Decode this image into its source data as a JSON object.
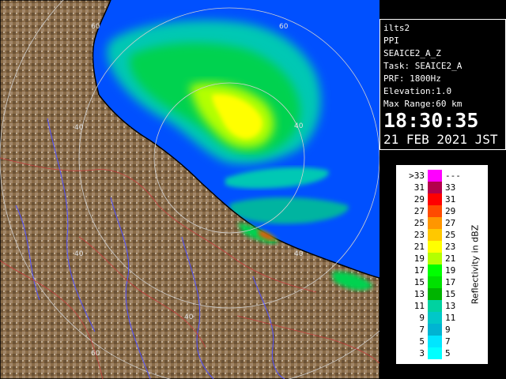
{
  "radar": {
    "station": "ilts2",
    "mode": "PPI",
    "product": "SEAICE2_A_Z",
    "task": "Task: SEAICE2_A",
    "prf": "PRF: 1800Hz",
    "elevation": "Elevation:1.0",
    "max_range": "Max Range:60 km",
    "time": "18:30:35",
    "date": "21 FEB 2021 JST"
  },
  "range_ring_labels": {
    "a": "60",
    "b": "60",
    "c": "40",
    "d": "40",
    "e": "40",
    "f": "40",
    "g": "40",
    "h": "60"
  },
  "legend": {
    "unit": "Reflectivity in dBZ",
    "rows": [
      {
        "low": ">33",
        "high": "---",
        "color": "#ff00ff"
      },
      {
        "low": "31",
        "high": "33",
        "color": "#b4004b"
      },
      {
        "low": "29",
        "high": "31",
        "color": "#ff0000"
      },
      {
        "low": "27",
        "high": "29",
        "color": "#ff4b00"
      },
      {
        "low": "25",
        "high": "27",
        "color": "#ff9600"
      },
      {
        "low": "23",
        "high": "25",
        "color": "#ffc800"
      },
      {
        "low": "21",
        "high": "23",
        "color": "#ffff00"
      },
      {
        "low": "19",
        "high": "21",
        "color": "#b4ff00"
      },
      {
        "low": "17",
        "high": "19",
        "color": "#00ff00"
      },
      {
        "low": "15",
        "high": "17",
        "color": "#00e100"
      },
      {
        "low": "13",
        "high": "15",
        "color": "#00b400"
      },
      {
        "low": "11",
        "high": "13",
        "color": "#00d2a0"
      },
      {
        "low": "9",
        "high": "11",
        "color": "#00c8c8"
      },
      {
        "low": "7",
        "high": "9",
        "color": "#00b4d2"
      },
      {
        "low": "5",
        "high": "7",
        "color": "#00e6ff"
      },
      {
        "low": "3",
        "high": "5",
        "color": "#00ffff"
      }
    ]
  },
  "colors": {
    "sea": "#0050ff",
    "land": "#8a6c48",
    "coast": "#000000",
    "rivers": "#5050ff",
    "borders": "#c83c3c",
    "rings": "#d0d0d0"
  }
}
